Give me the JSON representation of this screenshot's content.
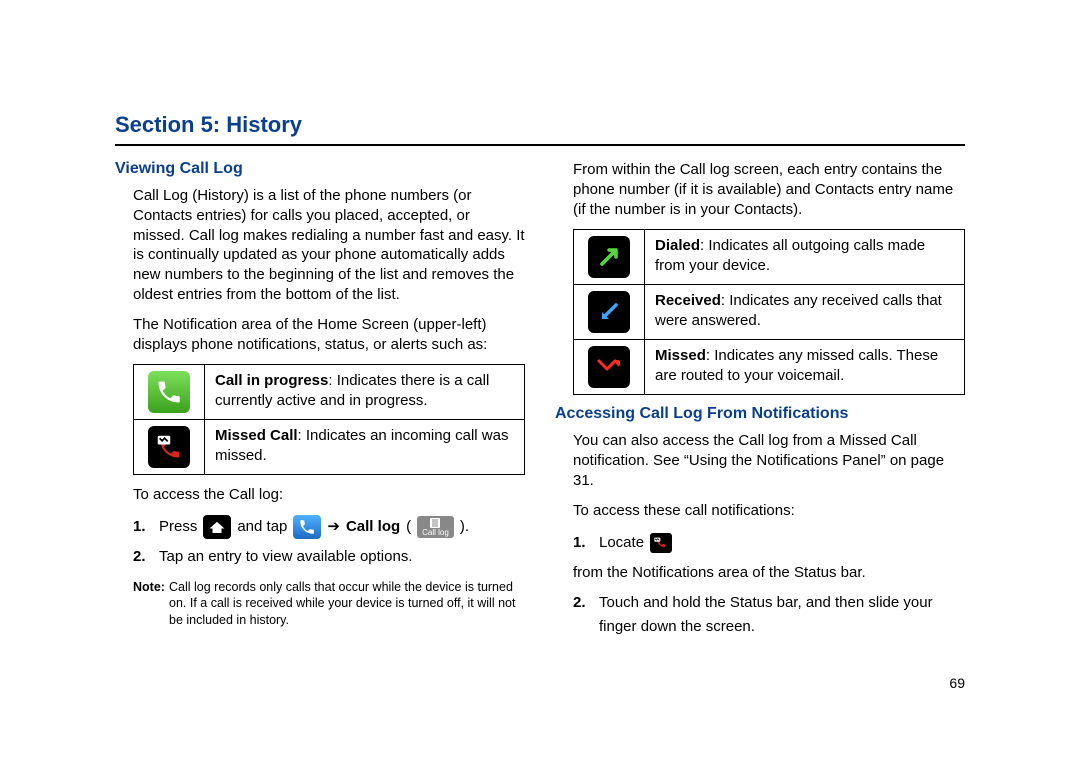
{
  "section_title": "Section 5: History",
  "col1": {
    "heading": "Viewing Call Log",
    "p1": "Call Log (History) is a list of the phone numbers (or Contacts entries) for calls you placed, accepted, or missed. Call log makes redialing a number fast and easy. It is continually updated as your phone automatically adds new numbers to the beginning of the list and removes the oldest entries from the bottom of the list.",
    "p2": "The Notification area of the Home Screen (upper-left) displays phone notifications, status, or alerts such as:",
    "table": [
      {
        "bold": "Call in progress",
        "text": ": Indicates there is a call currently active and in progress."
      },
      {
        "bold": "Missed Call",
        "text": ": Indicates an incoming call was missed."
      }
    ],
    "p3": "To access the Call log:",
    "step1_a": "Press",
    "step1_b": "and tap",
    "step1_arrow": "➔",
    "step1_cl": "Call log",
    "step1_par_open": "(",
    "step1_par_close": ").",
    "calllog_badge": "Call log",
    "step2": "Tap an entry to view available options.",
    "note_label": "Note:",
    "note_text": "Call log records only calls that occur while the device is turned on. If a call is received while your device is turned off, it will not be included in history."
  },
  "col2": {
    "p1": "From within the Call log screen, each entry contains the phone number (if it is available) and Contacts entry name (if the number is in your Contacts).",
    "table": [
      {
        "bold": "Dialed",
        "text": ": Indicates all outgoing calls made from your device."
      },
      {
        "bold": "Received",
        "text": ": Indicates any received calls that were answered."
      },
      {
        "bold": "Missed",
        "text": ": Indicates any missed calls. These are routed to your voicemail."
      }
    ],
    "heading2": "Accessing Call Log From Notifications",
    "p2": "You can also access the Call log from a Missed Call notification. See “Using the Notifications Panel” on page 31.",
    "p3": "To access these call notifications:",
    "step1_a": "Locate",
    "step1_b": "from the Notifications area of the Status bar.",
    "step2": "Touch and hold the Status bar, and then slide your finger down the screen."
  },
  "page_number": "69"
}
